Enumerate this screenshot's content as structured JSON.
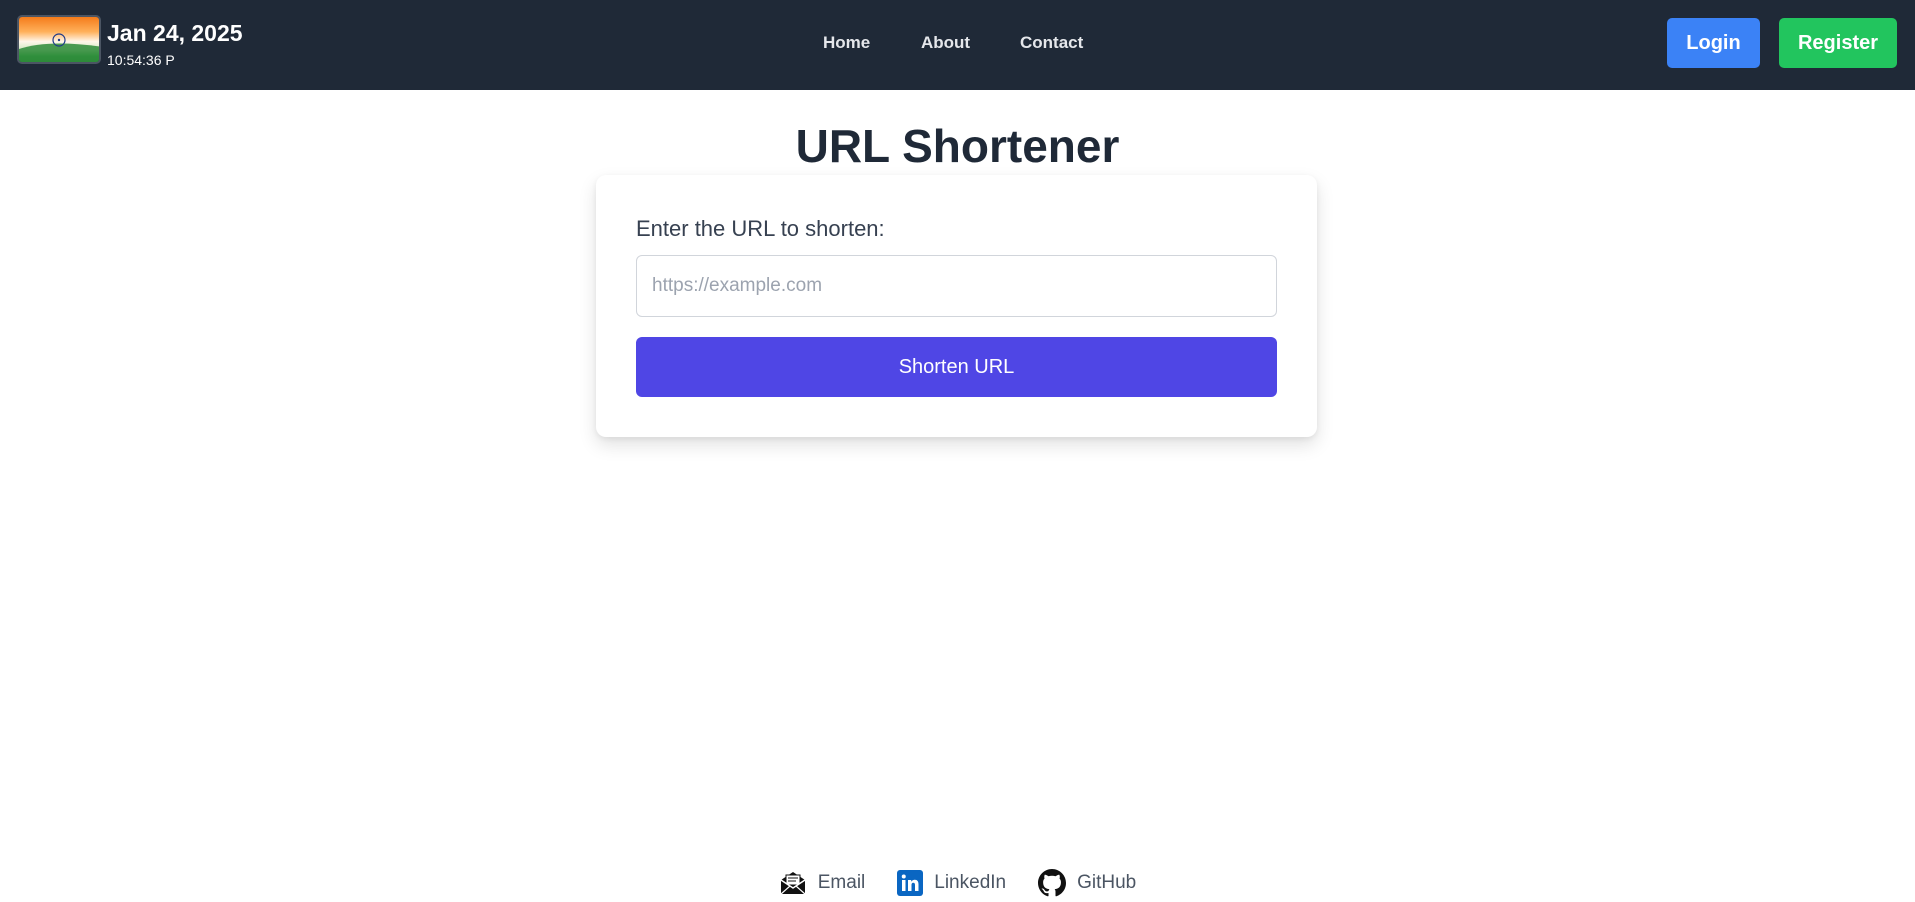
{
  "header": {
    "date": "Jan 24, 2025",
    "time": "10:54:36 P",
    "nav": {
      "home": "Home",
      "about": "About",
      "contact": "Contact"
    },
    "login_label": "Login",
    "register_label": "Register"
  },
  "main": {
    "title": "URL Shortener",
    "form": {
      "label": "Enter the URL to shorten:",
      "input_value": "",
      "input_placeholder": "https://example.com",
      "submit_label": "Shorten URL"
    }
  },
  "footer": {
    "links": [
      {
        "label": "Email",
        "icon": "envelope-icon"
      },
      {
        "label": "LinkedIn",
        "icon": "linkedin-icon"
      },
      {
        "label": "GitHub",
        "icon": "github-icon"
      }
    ]
  },
  "colors": {
    "header_bg": "#1f2937",
    "login": "#3b82f6",
    "register": "#22c55e",
    "primary": "#4f46e5",
    "linkedin": "#0a66c2"
  }
}
